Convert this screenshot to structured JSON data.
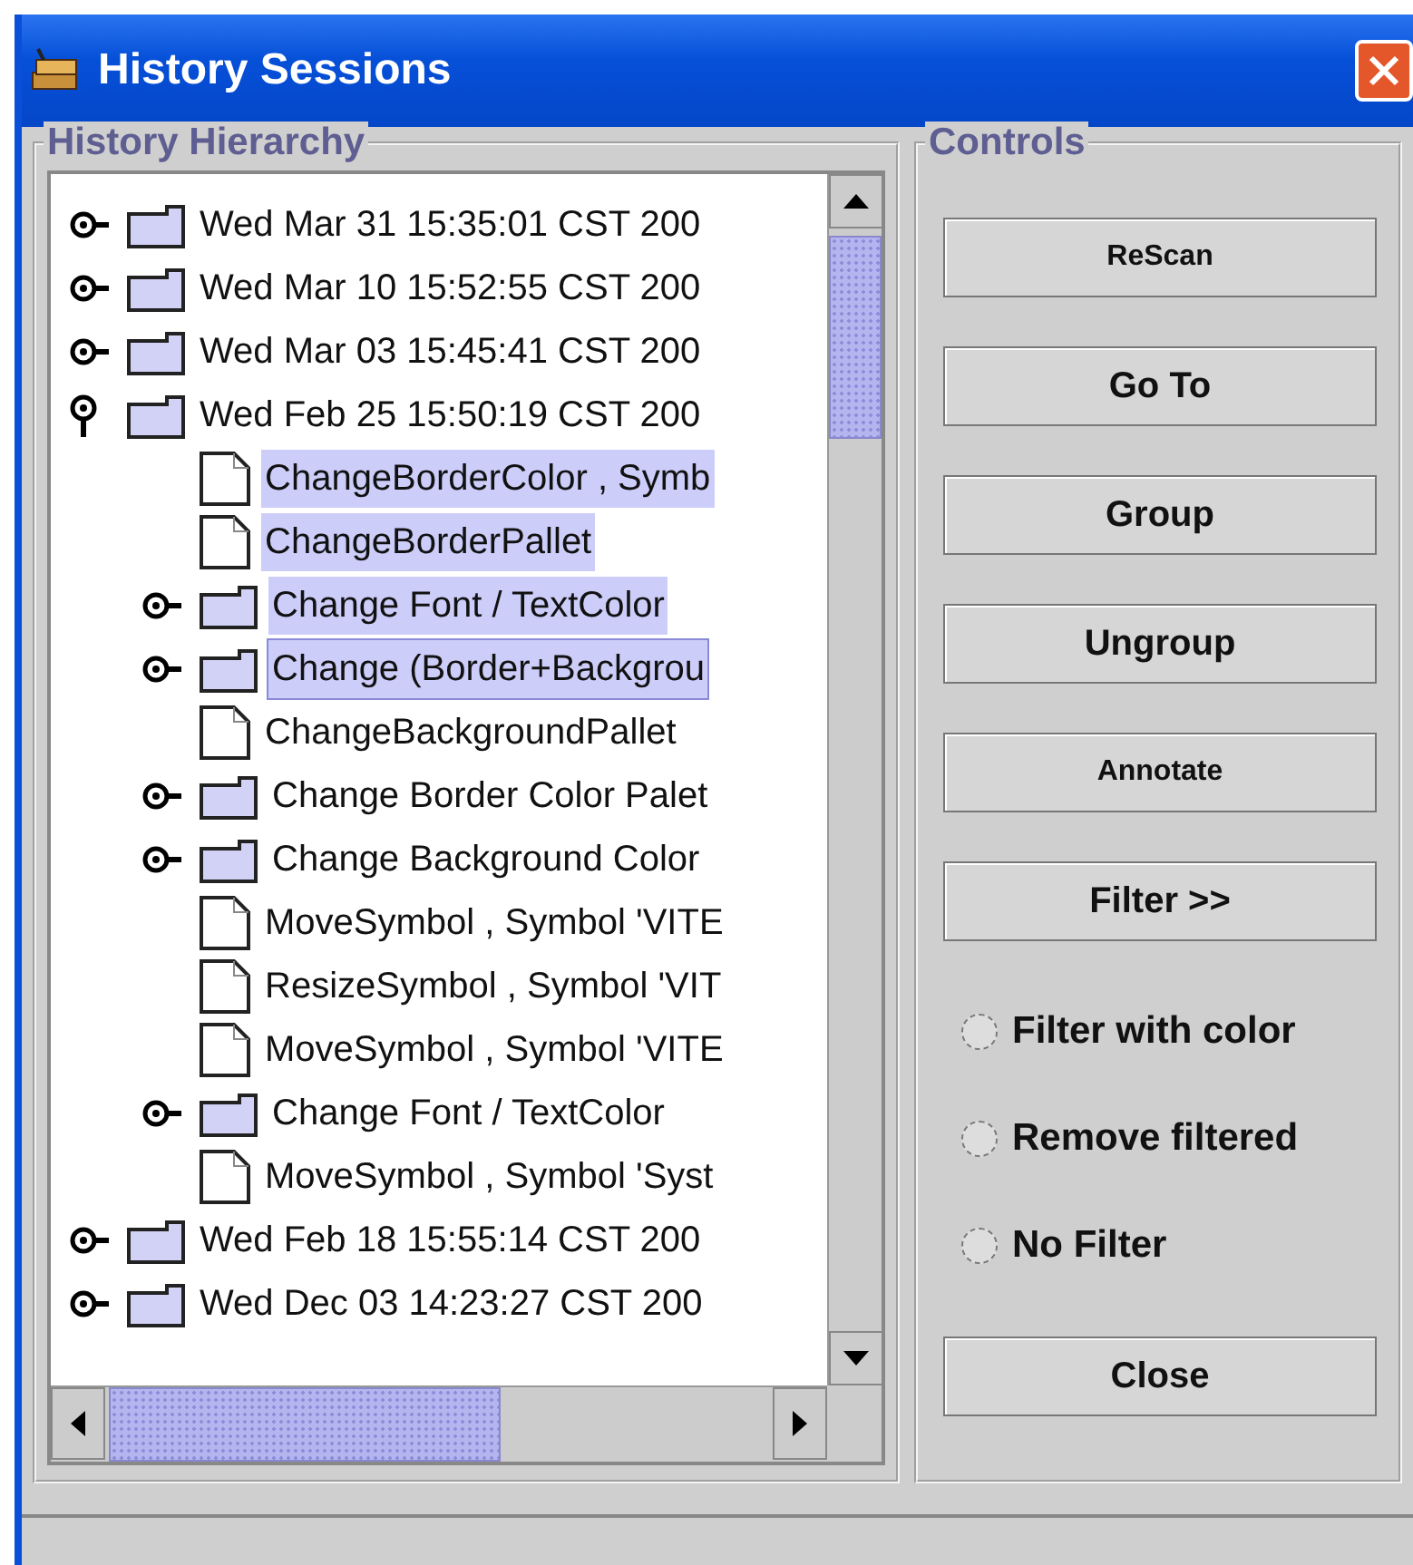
{
  "window": {
    "title": "History Sessions"
  },
  "hierarchy": {
    "title": "History Hierarchy",
    "items": [
      {
        "kind": "folder",
        "label": "Wed Mar 31 15:35:01 CST 200",
        "expanded": false,
        "selected": false
      },
      {
        "kind": "folder",
        "label": "Wed Mar 10 15:52:55 CST 200",
        "expanded": false,
        "selected": false
      },
      {
        "kind": "folder",
        "label": "Wed Mar 03 15:45:41 CST 200",
        "expanded": false,
        "selected": false
      },
      {
        "kind": "folder",
        "label": "Wed Feb 25 15:50:19 CST 200",
        "expanded": true,
        "selected": false,
        "children": [
          {
            "kind": "file",
            "label": "ChangeBorderColor , Symb",
            "selected": true
          },
          {
            "kind": "file",
            "label": "ChangeBorderPallet",
            "selected": true
          },
          {
            "kind": "folder",
            "label": "Change Font / TextColor",
            "expanded": false,
            "selected": true
          },
          {
            "kind": "folder",
            "label": "Change (Border+Backgrou",
            "expanded": false,
            "selected": true
          },
          {
            "kind": "file",
            "label": "ChangeBackgroundPallet",
            "selected": false
          },
          {
            "kind": "folder",
            "label": "Change Border Color Palet",
            "expanded": false,
            "selected": false
          },
          {
            "kind": "folder",
            "label": "Change Background Color",
            "expanded": false,
            "selected": false
          },
          {
            "kind": "file",
            "label": "MoveSymbol , Symbol 'VITE",
            "selected": false
          },
          {
            "kind": "file",
            "label": "ResizeSymbol , Symbol 'VIT",
            "selected": false
          },
          {
            "kind": "file",
            "label": "MoveSymbol , Symbol 'VITE",
            "selected": false
          },
          {
            "kind": "folder",
            "label": "Change Font / TextColor",
            "expanded": false,
            "selected": false
          },
          {
            "kind": "file",
            "label": "MoveSymbol , Symbol 'Syst",
            "selected": false
          }
        ]
      },
      {
        "kind": "folder",
        "label": "Wed Feb 18 15:55:14 CST 200",
        "expanded": false,
        "selected": false
      },
      {
        "kind": "folder",
        "label": "Wed Dec 03 14:23:27 CST 200",
        "expanded": false,
        "selected": false
      }
    ]
  },
  "controls": {
    "title": "Controls",
    "buttons": [
      "ReScan",
      "Go To",
      "Group",
      "Ungroup",
      "Annotate",
      "Filter >>"
    ],
    "radios": [
      {
        "label": "Filter with color",
        "selected": false
      },
      {
        "label": "Remove filtered",
        "selected": false
      },
      {
        "label": "No Filter",
        "selected": false
      }
    ],
    "close_button": "Close"
  }
}
